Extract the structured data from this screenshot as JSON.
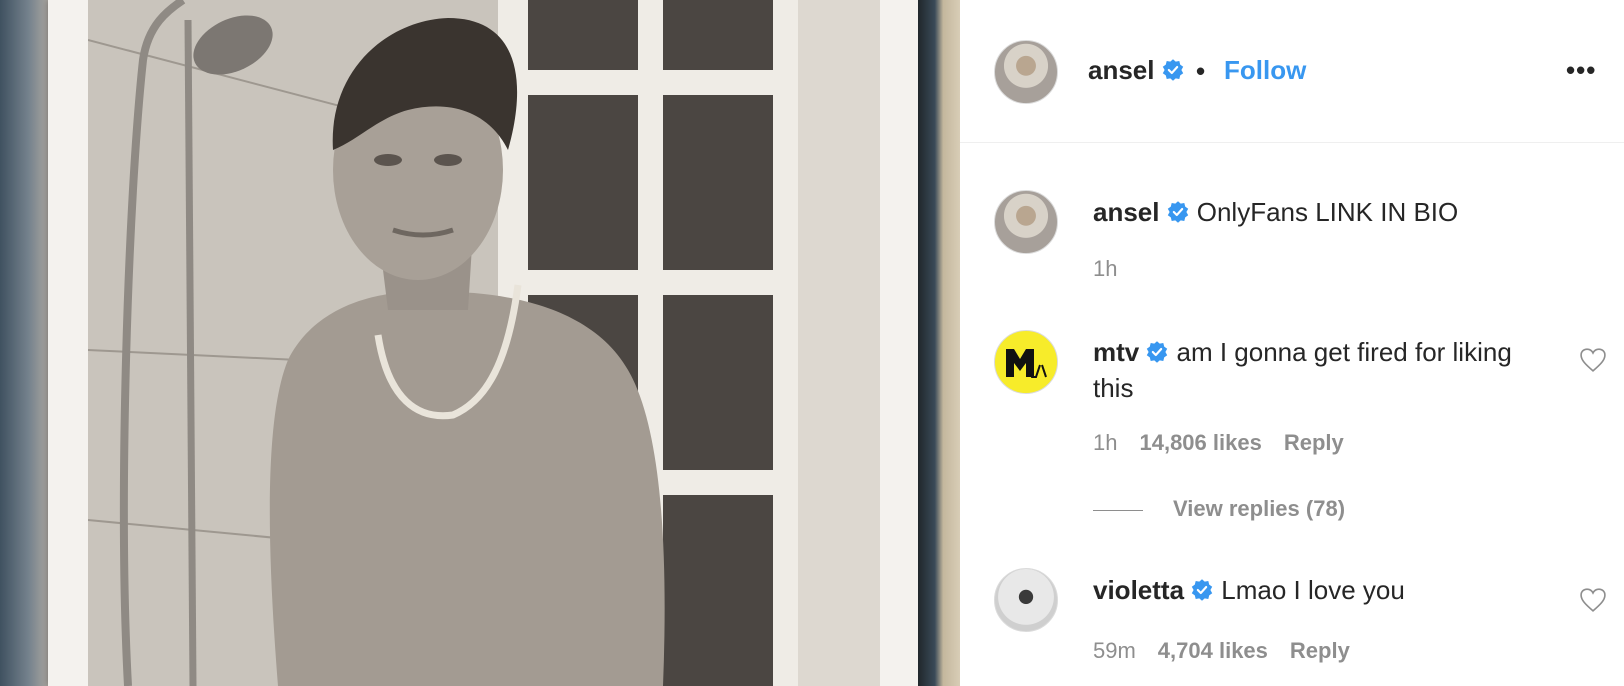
{
  "post": {
    "author": "ansel",
    "separator": "•",
    "follow_label": "Follow",
    "more_label": "•••"
  },
  "comments": [
    {
      "username": "ansel",
      "verified": true,
      "text": "OnlyFans LINK IN BIO",
      "time": "1h"
    },
    {
      "username": "mtv",
      "verified": true,
      "text": "am I gonna get fired for liking this",
      "time": "1h",
      "likes": "14,806 likes",
      "reply_label": "Reply",
      "view_replies": "View replies (78)"
    },
    {
      "username": "violetta",
      "verified": true,
      "text": "Lmao I love you",
      "time": "59m",
      "likes": "4,704 likes",
      "reply_label": "Reply"
    }
  ],
  "colors": {
    "link_blue": "#3897f0",
    "verified_blue": "#3897f0",
    "meta_gray": "#8e8e8e",
    "mtv_yellow": "#f7ec2a"
  },
  "icons": [
    "verified-badge-icon",
    "heart-icon",
    "more-options-icon",
    "mtv-logo"
  ]
}
